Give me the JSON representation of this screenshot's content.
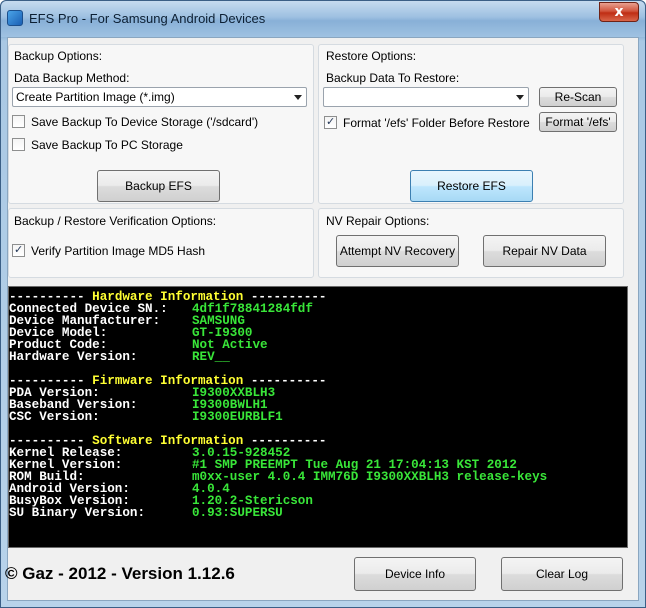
{
  "window": {
    "title": "EFS Pro - For Samsung Android Devices",
    "close_glyph": "x"
  },
  "backup": {
    "group_label": "Backup Options:",
    "method_label": "Data Backup Method:",
    "method_value": "Create Partition Image (*.img)",
    "save_device_label": "Save Backup To Device Storage ('/sdcard')",
    "save_device_checked": false,
    "save_pc_label": "Save Backup To PC Storage",
    "save_pc_checked": false,
    "backup_button": "Backup EFS"
  },
  "restore": {
    "group_label": "Restore Options:",
    "data_label": "Backup Data To Restore:",
    "data_value": "",
    "rescan_button": "Re-Scan",
    "format_label": "Format '/efs' Folder Before Restore",
    "format_checked": true,
    "format_button": "Format '/efs'",
    "restore_button": "Restore EFS"
  },
  "verify": {
    "group_label": "Backup / Restore Verification Options:",
    "md5_label": "Verify Partition Image MD5 Hash",
    "md5_checked": true
  },
  "nv": {
    "group_label": "NV Repair Options:",
    "recovery_button": "Attempt NV Recovery",
    "repair_button": "Repair NV Data"
  },
  "console": {
    "hardware_header": {
      "dashes_left": "---------- ",
      "name": "Hardware Information",
      "dashes_right": " ----------"
    },
    "hardware": [
      {
        "key": "Connected Device SN.:",
        "value": "4df1f78841284fdf"
      },
      {
        "key": "Device Manufacturer:",
        "value": "SAMSUNG"
      },
      {
        "key": "Device Model:",
        "value": "GT-I9300"
      },
      {
        "key": "Product Code:",
        "value": "Not Active"
      },
      {
        "key": "Hardware Version:",
        "value": "REV__"
      }
    ],
    "firmware_header": {
      "dashes_left": "---------- ",
      "name": "Firmware Information",
      "dashes_right": " ----------"
    },
    "firmware": [
      {
        "key": "PDA Version:",
        "value": "I9300XXBLH3"
      },
      {
        "key": "Baseband Version:",
        "value": "I9300BWLH1"
      },
      {
        "key": "CSC Version:",
        "value": "I9300EURBLF1"
      }
    ],
    "software_header": {
      "dashes_left": "---------- ",
      "name": "Software Information",
      "dashes_right": " ----------"
    },
    "software": [
      {
        "key": "Kernel Release:",
        "value": "3.0.15-928452"
      },
      {
        "key": "Kernel Version:",
        "value": "#1 SMP PREEMPT Tue Aug 21 17:04:13 KST 2012"
      },
      {
        "key": "ROM Build:",
        "value": "m0xx-user 4.0.4 IMM76D I9300XXBLH3 release-keys"
      },
      {
        "key": "Android Version:",
        "value": "4.0.4"
      },
      {
        "key": "BusyBox Version:",
        "value": "1.20.2-Stericson"
      },
      {
        "key": "SU Binary Version:",
        "value": "0.93:SUPERSU"
      }
    ]
  },
  "footer": {
    "copyright": "© Gaz - 2012 - Version 1.12.6",
    "device_info_button": "Device Info",
    "clear_log_button": "Clear Log"
  }
}
